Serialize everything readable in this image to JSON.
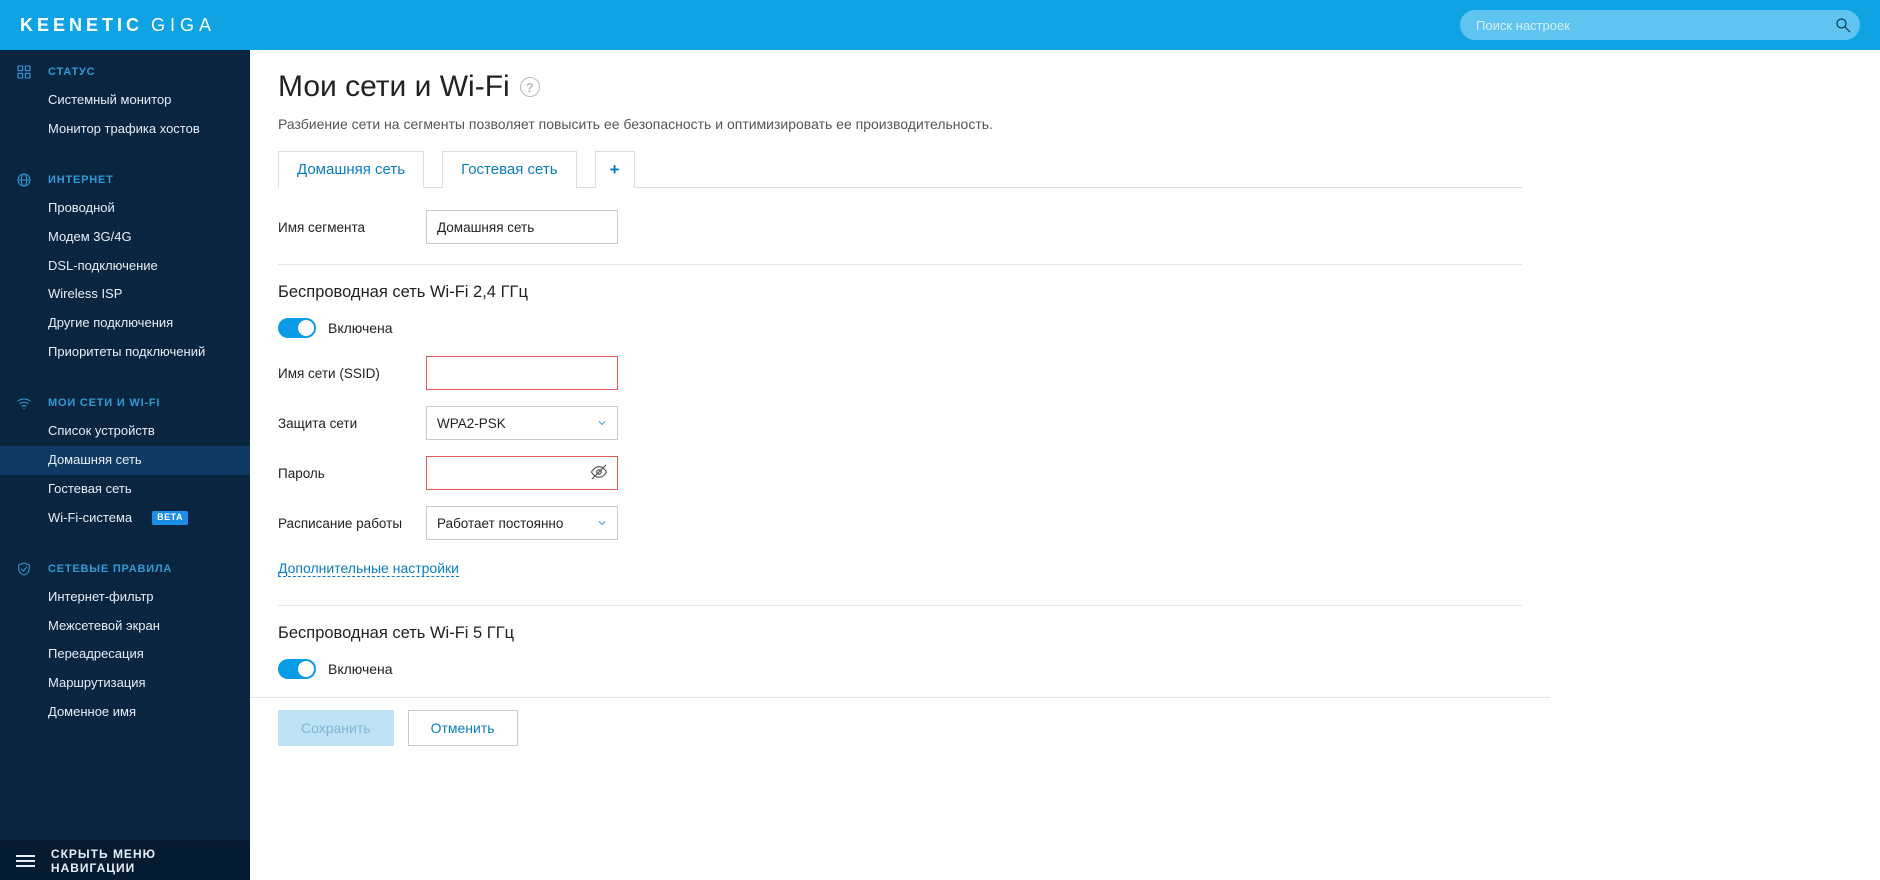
{
  "brand": {
    "name_main": "KEENETIC",
    "name_model": "GIGA"
  },
  "search": {
    "placeholder": "Поиск настроек"
  },
  "sidebar": {
    "groups": [
      {
        "label": "СТАТУС",
        "icon": "dashboard-icon",
        "items": [
          {
            "label": "Системный монитор"
          },
          {
            "label": "Монитор трафика хостов"
          }
        ]
      },
      {
        "label": "ИНТЕРНЕТ",
        "icon": "globe-icon",
        "items": [
          {
            "label": "Проводной"
          },
          {
            "label": "Модем 3G/4G"
          },
          {
            "label": "DSL-подключение"
          },
          {
            "label": "Wireless ISP"
          },
          {
            "label": "Другие подключения"
          },
          {
            "label": "Приоритеты подключений"
          }
        ]
      },
      {
        "label": "МОИ СЕТИ И WI-FI",
        "icon": "wifi-icon",
        "items": [
          {
            "label": "Список устройств"
          },
          {
            "label": "Домашняя сеть",
            "active": true
          },
          {
            "label": "Гостевая сеть"
          },
          {
            "label": "Wi-Fi-система",
            "badge": "BETA"
          }
        ]
      },
      {
        "label": "СЕТЕВЫЕ ПРАВИЛА",
        "icon": "shield-icon",
        "items": [
          {
            "label": "Интернет-фильтр"
          },
          {
            "label": "Межсетевой экран"
          },
          {
            "label": "Переадресация"
          },
          {
            "label": "Маршрутизация"
          },
          {
            "label": "Доменное имя"
          }
        ]
      }
    ],
    "collapse_label": "СКРЫТЬ МЕНЮ НАВИГАЦИИ"
  },
  "page": {
    "title": "Мои сети и Wi-Fi",
    "subtitle": "Разбиение сети на сегменты позволяет повысить ее безопасность и оптимизировать ее производительность."
  },
  "tabs": [
    {
      "label": "Домашняя сеть",
      "active": true
    },
    {
      "label": "Гостевая сеть"
    }
  ],
  "segment": {
    "name_label": "Имя сегмента",
    "name_value": "Домашняя сеть"
  },
  "wifi24": {
    "section_title": "Беспроводная сеть Wi-Fi 2,4 ГГц",
    "enabled_label": "Включена",
    "ssid_label": "Имя сети (SSID)",
    "ssid_value": "",
    "security_label": "Защита сети",
    "security_value": "WPA2-PSK",
    "password_label": "Пароль",
    "password_value": "",
    "schedule_label": "Расписание работы",
    "schedule_value": "Работает постоянно",
    "more_link": "Дополнительные настройки"
  },
  "wifi5": {
    "section_title": "Беспроводная сеть Wi-Fi 5 ГГц",
    "enabled_label": "Включена"
  },
  "actions": {
    "save": "Сохранить",
    "cancel": "Отменить"
  }
}
